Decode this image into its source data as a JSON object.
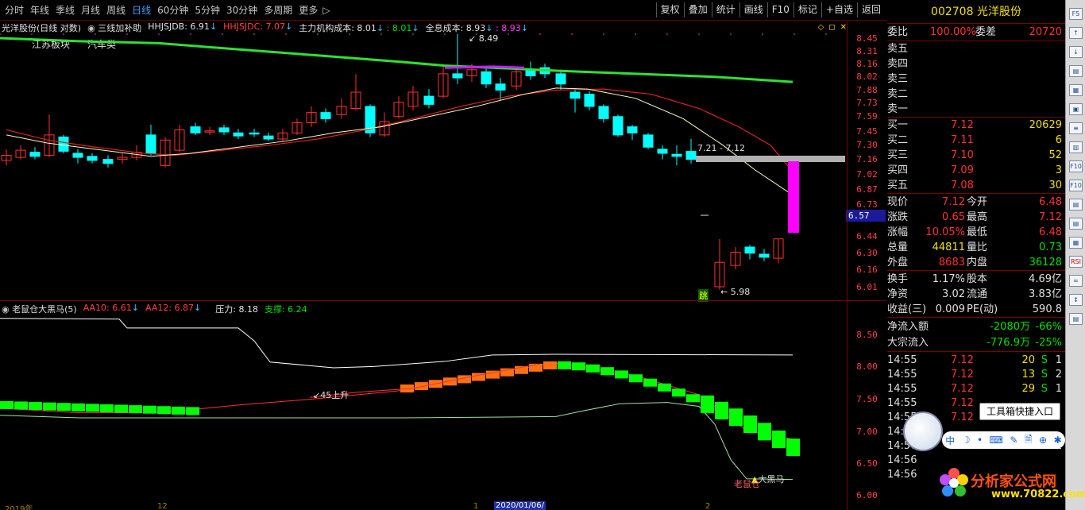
{
  "toolbar": {
    "periods": [
      "分时",
      "年线",
      "季线",
      "月线",
      "周线",
      "日线",
      "60分钟",
      "5分钟",
      "30分钟",
      "多周期",
      "更多"
    ],
    "active_period": "日线",
    "more_arrow": "▷",
    "buttons": [
      "复权",
      "叠加",
      "统计",
      "画线",
      "F10",
      "标记",
      "+自选",
      "返回"
    ]
  },
  "main_header": {
    "stock": "光洋股份(日线 对数)",
    "indicator": "三线加补助",
    "hhjsjdb_label": "HHJSJDB: 6.91",
    "hhjsjdc_label": "HHJSJDC: 7.07",
    "zhuli_label": "主力机构成本: 8.01",
    "zhuli_sub": ": 8.01",
    "quanxi_label": "全息成本: 8.93",
    "quanxi_sub": ": 8.93"
  },
  "sectors": [
    "江苏板块",
    "汽车类"
  ],
  "price_axis": [
    "8.45",
    "8.31",
    "8.16",
    "8.02",
    "7.88",
    "7.73",
    "7.59",
    "7.45",
    "7.30",
    "7.16",
    "7.02",
    "6.87",
    "6.73",
    "6.57",
    "6.44",
    "6.30",
    "6.16",
    "6.01"
  ],
  "current_price_tag": "6.57",
  "annotations": {
    "high": "8.49",
    "low": "5.98",
    "gap": "7.21 - 7.12",
    "jump": "跳"
  },
  "indicator_header": {
    "name": "老鼠仓大黑马(5)",
    "aa10": "AA10: 6.61",
    "aa12": "AA12: 6.87",
    "pressure": "压力: 8.18",
    "support": "支撑: 6.24"
  },
  "indicator_axis": [
    "8.50",
    "8.00",
    "7.50",
    "7.00",
    "6.50",
    "6.00"
  ],
  "indicator_labels": {
    "up45": "45上升",
    "black_horse": "大黑马",
    "rat": "老鼠仓"
  },
  "date_strip": {
    "left": "2019年",
    "mid1": "12",
    "mid2": "1",
    "selected": "2020/01/06/",
    "right": "2"
  },
  "quote": {
    "code": "002708",
    "name": "光洋股份",
    "weibi_label": "委比",
    "weibi_value": "100.00%",
    "weicha_label": "委差",
    "weicha_value": "20720",
    "sells": [
      {
        "label": "卖五",
        "price": "",
        "vol": ""
      },
      {
        "label": "卖四",
        "price": "",
        "vol": ""
      },
      {
        "label": "卖三",
        "price": "",
        "vol": ""
      },
      {
        "label": "卖二",
        "price": "",
        "vol": ""
      },
      {
        "label": "卖一",
        "price": "",
        "vol": ""
      }
    ],
    "buys": [
      {
        "label": "买一",
        "price": "7.12",
        "vol": "20629"
      },
      {
        "label": "买二",
        "price": "7.11",
        "vol": "6"
      },
      {
        "label": "买三",
        "price": "7.10",
        "vol": "52"
      },
      {
        "label": "买四",
        "price": "7.09",
        "vol": "3"
      },
      {
        "label": "买五",
        "price": "7.08",
        "vol": "30"
      }
    ],
    "stats": [
      {
        "l1": "现价",
        "v1": "7.12",
        "c1": "red",
        "l2": "今开",
        "v2": "6.48",
        "c2": "red"
      },
      {
        "l1": "涨跌",
        "v1": "0.65",
        "c1": "red",
        "l2": "最高",
        "v2": "7.12",
        "c2": "red"
      },
      {
        "l1": "涨幅",
        "v1": "10.05%",
        "c1": "red",
        "l2": "最低",
        "v2": "6.48",
        "c2": "red"
      },
      {
        "l1": "总量",
        "v1": "44811",
        "c1": "yellow",
        "l2": "量比",
        "v2": "0.73",
        "c2": "green"
      },
      {
        "l1": "外盘",
        "v1": "8683",
        "c1": "red",
        "l2": "内盘",
        "v2": "36128",
        "c2": "green"
      }
    ],
    "fund": [
      {
        "l1": "换手",
        "v1": "1.17%",
        "l2": "股本",
        "v2": "4.69亿"
      },
      {
        "l1": "净资",
        "v1": "3.02",
        "l2": "流通",
        "v2": "3.83亿"
      },
      {
        "l1": "收益(三)",
        "v1": "0.009",
        "l2": "PE(动)",
        "v2": "590.8"
      }
    ],
    "flows": [
      {
        "label": "净流入额",
        "value": "-2080万",
        "pct": "-66%"
      },
      {
        "label": "大宗流入",
        "value": "-776.9万",
        "pct": "-25%"
      }
    ],
    "ticks": [
      {
        "time": "14:55",
        "price": "7.12",
        "vol": "20",
        "side": "S",
        "n": "1"
      },
      {
        "time": "14:55",
        "price": "7.12",
        "vol": "13",
        "side": "S",
        "n": "2"
      },
      {
        "time": "14:55",
        "price": "7.12",
        "vol": "29",
        "side": "S",
        "n": "1"
      },
      {
        "time": "14:55",
        "price": "7.12",
        "vol": "",
        "side": "",
        "n": ""
      },
      {
        "time": "14:55",
        "price": "7.12",
        "vol": "",
        "side": "",
        "n": ""
      },
      {
        "time": "14:56",
        "price": "",
        "vol": "",
        "side": "",
        "n": ""
      },
      {
        "time": "14:56",
        "price": "7.12",
        "vol": "300",
        "side": "S",
        "n": "1"
      },
      {
        "time": "14:56",
        "price": "",
        "vol": "",
        "side": "",
        "n": ""
      },
      {
        "time": "14:56",
        "price": "",
        "vol": "",
        "side": "",
        "n": ""
      }
    ]
  },
  "tool_popup": "工具箱快捷入口",
  "helper_bar_items": [
    "中",
    "☽",
    "•",
    "⌨",
    "✎",
    "🗎",
    "⊕",
    "✱"
  ],
  "watermark": {
    "text": "分析家公式网",
    "url": "www.70822.com"
  },
  "side_icons": [
    "F5",
    "↑",
    "↓",
    "▤",
    "▦",
    "▣",
    "≡",
    "▥",
    "F10",
    "F10",
    "▤",
    "▤",
    "▦",
    "RSI",
    "≈",
    "↕",
    "▤"
  ]
}
